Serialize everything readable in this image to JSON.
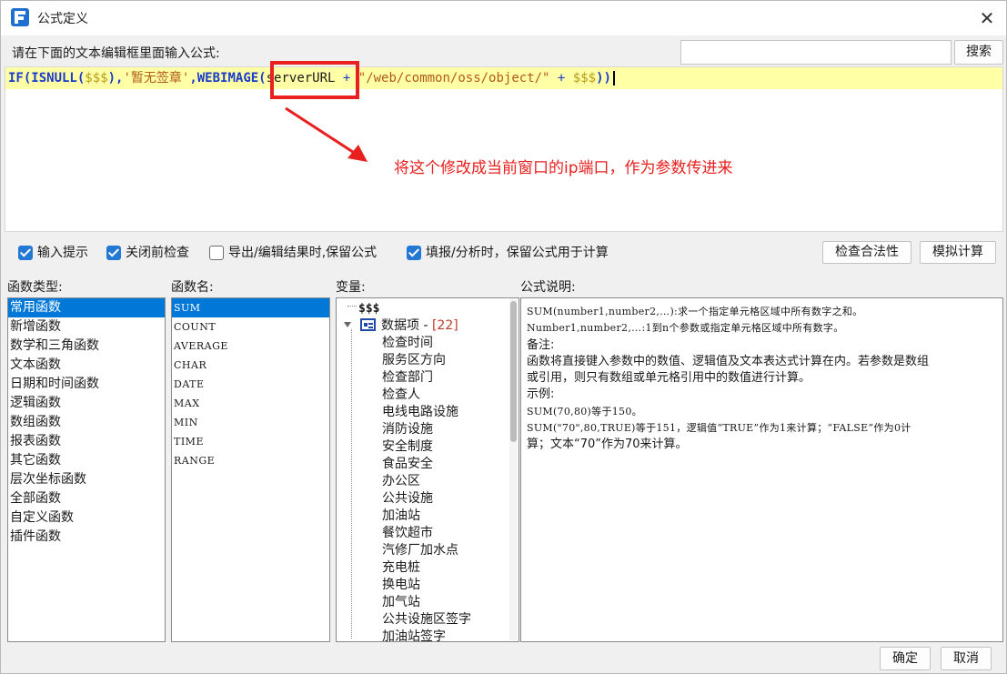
{
  "window": {
    "title": "公式定义"
  },
  "prompt_label": "请在下面的文本编辑框里面输入公式:",
  "search": {
    "button_label": "搜索",
    "value": ""
  },
  "formula": {
    "tokens": [
      "IF(ISNULL(",
      "$$$",
      "),",
      "'暂无签章'",
      ",WEBIMAGE(",
      "serverURL",
      " + ",
      "\"/web/common/oss/object/\"",
      " + ",
      "$$$",
      "))"
    ]
  },
  "annotation": {
    "text": "将这个修改成当前窗口的ip端口，作为参数传进来",
    "color": "#e8201f"
  },
  "options": [
    {
      "label": "输入提示",
      "checked": true
    },
    {
      "label": "关闭前检查",
      "checked": true
    },
    {
      "label": "导出/编辑结果时,保留公式",
      "checked": false
    },
    {
      "label": "填报/分析时，保留公式用于计算",
      "checked": true
    }
  ],
  "actions": {
    "check_label": "检查合法性",
    "simulate_label": "模拟计算",
    "ok_label": "确定",
    "cancel_label": "取消"
  },
  "panels": {
    "types_label": "函数类型:",
    "names_label": "函数名:",
    "vars_label": "变量:",
    "desc_label": "公式说明:"
  },
  "function_types": [
    "常用函数",
    "新增函数",
    "数学和三角函数",
    "文本函数",
    "日期和时间函数",
    "逻辑函数",
    "数组函数",
    "报表函数",
    "其它函数",
    "层次坐标函数",
    "全部函数",
    "自定义函数",
    "插件函数"
  ],
  "function_names": [
    "SUM",
    "COUNT",
    "AVERAGE",
    "CHAR",
    "DATE",
    "MAX",
    "MIN",
    "TIME",
    "RANGE"
  ],
  "variables": {
    "root": "$$$",
    "node_label": "数据项 - ",
    "node_count": "[22]",
    "children": [
      "检查时间",
      "服务区方向",
      "检查部门",
      "检查人",
      "电线电路设施",
      "消防设施",
      "安全制度",
      "食品安全",
      "办公区",
      "公共设施",
      "加油站",
      "餐饮超市",
      "汽修厂加水点",
      "充电桩",
      "换电站",
      "加气站",
      "公共设施区签字",
      "加油站签字"
    ]
  },
  "description": {
    "line1": "SUM(number1,number2,…):求一个指定单元格区域中所有数字之和。",
    "line2": "Number1,number2,…:1到n个参数或指定单元格区域中所有数字。",
    "line3": "备注:",
    "line4": "函数将直接键入参数中的数值、逻辑值及文本表达式计算在内。若参数是数组",
    "line5": "或引用，则只有数组或单元格引用中的数值进行计算。",
    "line6": "示例:",
    "line7": "SUM(70,80)等于150。",
    "line8": "SUM(\"70\",80,TRUE)等于151，逻辑值“TRUE”作为1来计算；“FALSE”作为0计",
    "line9": "算；文本“70”作为70来计算。"
  }
}
